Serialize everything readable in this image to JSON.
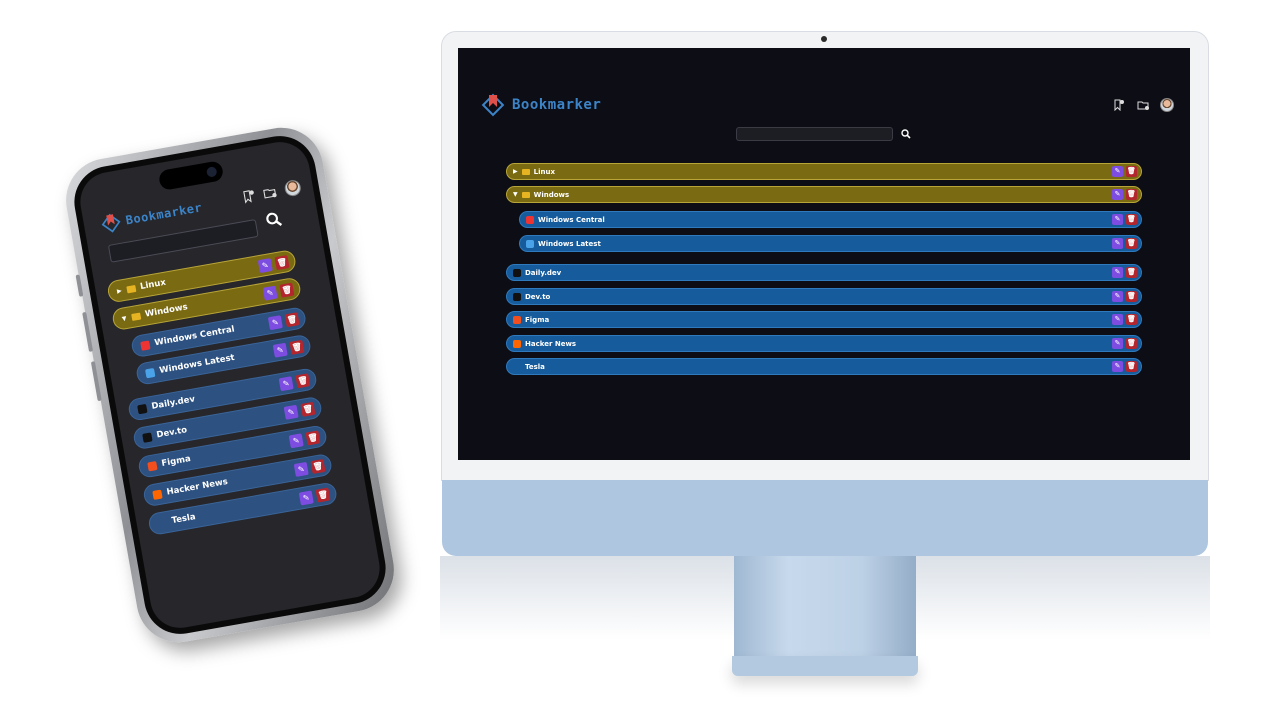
{
  "app": {
    "name": "Bookmarker",
    "accent": "#3c84c8",
    "logo_color": "#e0504a"
  },
  "header": {
    "icons": [
      "add-bookmark-icon",
      "add-folder-icon",
      "user-avatar"
    ]
  },
  "search": {
    "placeholder": "",
    "icon": "search-icon"
  },
  "colors": {
    "folder_bg": "#7a6a12",
    "link_bg": "#165c9c",
    "edit": "#7d4ce0",
    "delete": "#b3262d"
  },
  "folders": [
    {
      "label": "Linux",
      "expanded": false
    },
    {
      "label": "Windows",
      "expanded": true,
      "children": [
        {
          "label": "Windows Central",
          "favicon": "windows-central-favicon"
        },
        {
          "label": "Windows Latest",
          "favicon": "windows-latest-favicon"
        }
      ]
    }
  ],
  "bookmarks": [
    {
      "label": "Daily.dev",
      "favicon": "daily-dev-favicon"
    },
    {
      "label": "Dev.to",
      "favicon": "dev-to-favicon"
    },
    {
      "label": "Figma",
      "favicon": "figma-favicon"
    },
    {
      "label": "Hacker News",
      "favicon": "hacker-news-favicon"
    },
    {
      "label": "Tesla",
      "favicon": "tesla-favicon"
    }
  ],
  "actions": {
    "edit_glyph": "✎",
    "delete_glyph": "🗑"
  }
}
